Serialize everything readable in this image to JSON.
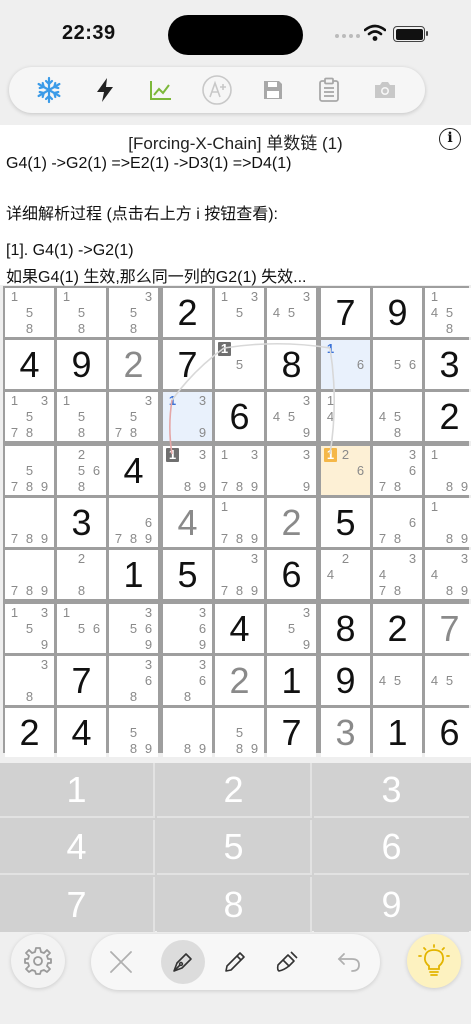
{
  "status": {
    "time": "22:39"
  },
  "toolbar": {
    "buttons": [
      {
        "name": "snowflake-icon",
        "color": "#3b9be8"
      },
      {
        "name": "lightning-icon",
        "color": "#222222"
      },
      {
        "name": "chart-icon",
        "color": "#7cb83a"
      },
      {
        "name": "ai-icon",
        "color": "#c8c8c8"
      },
      {
        "name": "save-icon",
        "color": "#a8a8a8"
      },
      {
        "name": "clipboard-icon",
        "color": "#a8a8a8"
      },
      {
        "name": "camera-icon",
        "color": "#c8c8c8"
      }
    ]
  },
  "hint": {
    "title": "[Forcing-X-Chain] 单数链 (1)",
    "chain": "G4(1) ->G2(1) =>E2(1) ->D3(1) =>D4(1)",
    "detail_prompt": "详细解析过程 (点击右上方 i 按钮查看):",
    "step1": "[1]. G4(1) ->G2(1)",
    "step1_desc": "如果G4(1) 生效,那么同一列的G2(1) 失效..."
  },
  "grid": {
    "rows": [
      [
        {
          "c": [
            1,
            5,
            8
          ]
        },
        {
          "c": [
            1,
            5,
            8
          ]
        },
        {
          "c": [
            3,
            5,
            8
          ]
        },
        {
          "v": 2,
          "t": "g"
        },
        {
          "c": [
            1,
            3,
            5
          ]
        },
        {
          "c": [
            3,
            4,
            5
          ]
        },
        {
          "v": 7,
          "t": "g"
        },
        {
          "v": 9,
          "t": "g"
        },
        {
          "c": [
            1,
            4,
            5,
            8
          ]
        }
      ],
      [
        {
          "v": 4,
          "t": "g"
        },
        {
          "v": 9,
          "t": "g"
        },
        {
          "v": 2,
          "t": "u"
        },
        {
          "v": 7,
          "t": "g"
        },
        {
          "c": [
            1,
            5
          ],
          "gray": 1
        },
        {
          "v": 8,
          "t": "g"
        },
        {
          "c": [
            1,
            6
          ],
          "blue": 1,
          "bg": "blue"
        },
        {
          "c": [
            5,
            6
          ]
        },
        {
          "v": 3,
          "t": "g"
        }
      ],
      [
        {
          "c": [
            1,
            3,
            5,
            7,
            8
          ]
        },
        {
          "c": [
            1,
            5,
            8
          ]
        },
        {
          "c": [
            3,
            5,
            7,
            8
          ]
        },
        {
          "c": [
            1,
            3,
            9
          ],
          "blue": 1,
          "bg": "blue"
        },
        {
          "v": 6,
          "t": "g"
        },
        {
          "c": [
            3,
            4,
            5,
            9
          ]
        },
        {
          "c": [
            1,
            4
          ]
        },
        {
          "c": [
            4,
            5,
            8
          ]
        },
        {
          "v": 2,
          "t": "g"
        }
      ],
      [
        {
          "c": [
            5,
            7,
            8,
            9
          ]
        },
        {
          "c": [
            2,
            5,
            6,
            8
          ]
        },
        {
          "v": 4,
          "t": "g"
        },
        {
          "c": [
            1,
            3,
            8,
            9
          ],
          "gray": 1
        },
        {
          "c": [
            1,
            3,
            7,
            8,
            9
          ]
        },
        {
          "c": [
            3,
            9
          ]
        },
        {
          "c": [
            1,
            2,
            6
          ],
          "orange": 1,
          "bg": "orange"
        },
        {
          "c": [
            3,
            6,
            7,
            8
          ]
        },
        {
          "c": [
            1,
            8,
            9
          ]
        }
      ],
      [
        {
          "c": [
            7,
            8,
            9
          ]
        },
        {
          "v": 3,
          "t": "g"
        },
        {
          "c": [
            6,
            7,
            8,
            9
          ]
        },
        {
          "v": 4,
          "t": "u"
        },
        {
          "c": [
            1,
            7,
            8,
            9
          ]
        },
        {
          "v": 2,
          "t": "u"
        },
        {
          "v": 5,
          "t": "g"
        },
        {
          "c": [
            6,
            7,
            8
          ]
        },
        {
          "c": [
            1,
            8,
            9
          ]
        }
      ],
      [
        {
          "c": [
            7,
            8,
            9
          ]
        },
        {
          "c": [
            2,
            8
          ]
        },
        {
          "v": 1,
          "t": "g"
        },
        {
          "v": 5,
          "t": "g"
        },
        {
          "c": [
            3,
            7,
            8,
            9
          ]
        },
        {
          "v": 6,
          "t": "g"
        },
        {
          "c": [
            2,
            4
          ]
        },
        {
          "c": [
            3,
            4,
            7,
            8
          ]
        },
        {
          "c": [
            3,
            4,
            8,
            9
          ]
        }
      ],
      [
        {
          "c": [
            1,
            3,
            5,
            9
          ]
        },
        {
          "c": [
            1,
            5,
            6
          ]
        },
        {
          "c": [
            3,
            5,
            6,
            9
          ]
        },
        {
          "c": [
            3,
            6,
            9
          ]
        },
        {
          "v": 4,
          "t": "g"
        },
        {
          "c": [
            3,
            5,
            9
          ]
        },
        {
          "v": 8,
          "t": "g"
        },
        {
          "v": 2,
          "t": "g"
        },
        {
          "v": 7,
          "t": "u"
        }
      ],
      [
        {
          "c": [
            3,
            8
          ]
        },
        {
          "v": 7,
          "t": "g"
        },
        {
          "c": [
            3,
            6,
            8
          ]
        },
        {
          "c": [
            3,
            6,
            8
          ]
        },
        {
          "v": 2,
          "t": "u"
        },
        {
          "v": 1,
          "t": "g"
        },
        {
          "v": 9,
          "t": "g"
        },
        {
          "c": [
            4,
            5
          ]
        },
        {
          "c": [
            4,
            5
          ]
        }
      ],
      [
        {
          "v": 2,
          "t": "g"
        },
        {
          "v": 4,
          "t": "g"
        },
        {
          "c": [
            5,
            8,
            9
          ]
        },
        {
          "c": [
            8,
            9
          ]
        },
        {
          "c": [
            5,
            8,
            9
          ]
        },
        {
          "v": 7,
          "t": "g"
        },
        {
          "v": 3,
          "t": "u"
        },
        {
          "v": 1,
          "t": "g"
        },
        {
          "v": 6,
          "t": "g"
        }
      ]
    ]
  },
  "keypad": {
    "keys": [
      "1",
      "2",
      "3",
      "4",
      "5",
      "6",
      "7",
      "8",
      "9"
    ]
  },
  "colors": {
    "chain_link": "#d8d8d8",
    "chain_strong": "#e4a6a6",
    "highlight_blue": "#3b73d8",
    "highlight_orange": "#f5b747"
  }
}
